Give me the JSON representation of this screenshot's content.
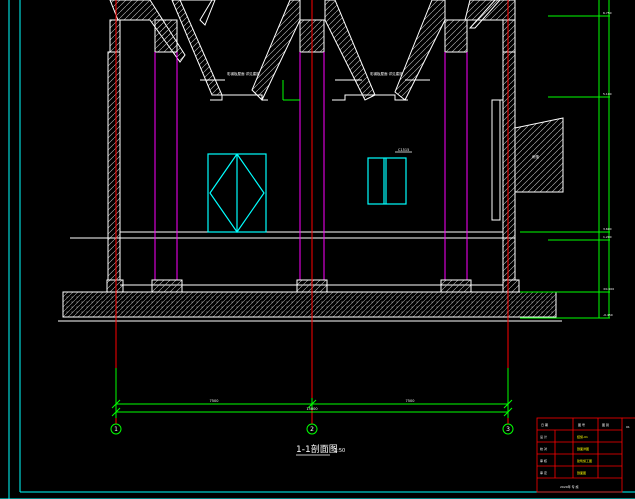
{
  "drawing": {
    "title": "1-1剖面图",
    "scale": "1:50",
    "axes": [
      {
        "id": "axis-1",
        "label": "1"
      },
      {
        "id": "axis-2",
        "label": "2"
      },
      {
        "id": "axis-3",
        "label": "3"
      }
    ],
    "dimensions": {
      "span_left": "7500",
      "span_right": "7500",
      "total": "15000"
    },
    "annotations": {
      "roof_note_left": "彩钢板屋面 详见建施",
      "roof_note_right": "彩钢板屋面 详见建施",
      "window_tag": "C1515",
      "canopy_tag": "雨篷"
    },
    "elevations": [
      "6.750",
      "5.100",
      "3.600",
      "1.200",
      "±0.000",
      "-0.450"
    ],
    "title_block": {
      "header": [
        "日 期",
        "图 号",
        "图 别"
      ],
      "rows": [
        {
          "role": "设 计",
          "value": "结施-01"
        },
        {
          "role": "校 对",
          "value": "剖面详图"
        },
        {
          "role": "审 核",
          "value": "建筑施工图"
        },
        {
          "role": "审 定",
          "value": "剖面图"
        }
      ],
      "footer": "2020年  专  施",
      "sheet": "01"
    }
  },
  "colors": {
    "background": "#000000",
    "structure": "#ffffff",
    "dimension": "#00ff00",
    "axis": "#ff0000",
    "column": "#ff00ff",
    "opening": "#00ffff",
    "frame": "#00ffff",
    "note": "#ffff00"
  }
}
